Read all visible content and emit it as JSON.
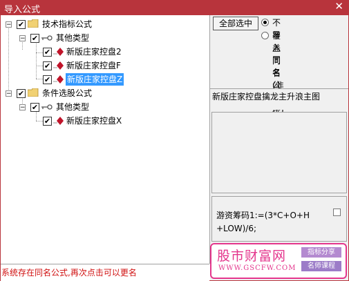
{
  "window": {
    "title": "导入公式",
    "close_glyph": "✕"
  },
  "tree": {
    "groups": [
      {
        "label": "技术指标公式",
        "sub": {
          "label": "其他类型",
          "items": [
            "新版庄家控盘2",
            "新版庄家控盘F",
            "新版庄家控盘Z"
          ]
        }
      },
      {
        "label": "条件选股公式",
        "sub": {
          "label": "其他类型",
          "items": [
            "新版庄家控盘X"
          ]
        }
      }
    ],
    "selected_item": "新版庄家控盘Z"
  },
  "right": {
    "select_all_label": "全部选中",
    "radio_options": [
      "不导入同名公式",
      "覆盖同名(非系统)"
    ],
    "radio_selected_index": 0,
    "formula_name": "新版庄家控盘擒龙主升浪主图",
    "code_line1": "游资筹码1:=(3*C+O+H",
    "code_line2": "+LOW)/6;"
  },
  "status": {
    "message": "系统存在同名公式,再次点击可以更名"
  },
  "watermark": {
    "brand": "股市财富网",
    "url": "WWW.GSCFW.COM",
    "tag1": "指标分享",
    "tag2": "名师课程"
  },
  "colors": {
    "titlebar": "#b8343c",
    "selection": "#3399ff",
    "status_text": "#d01010",
    "watermark": "#e4358c"
  },
  "icons": {
    "folder": "folder-icon",
    "key": "key-icon",
    "formula": "formula-diamond-icon",
    "expander": "minus-expander-icon"
  }
}
